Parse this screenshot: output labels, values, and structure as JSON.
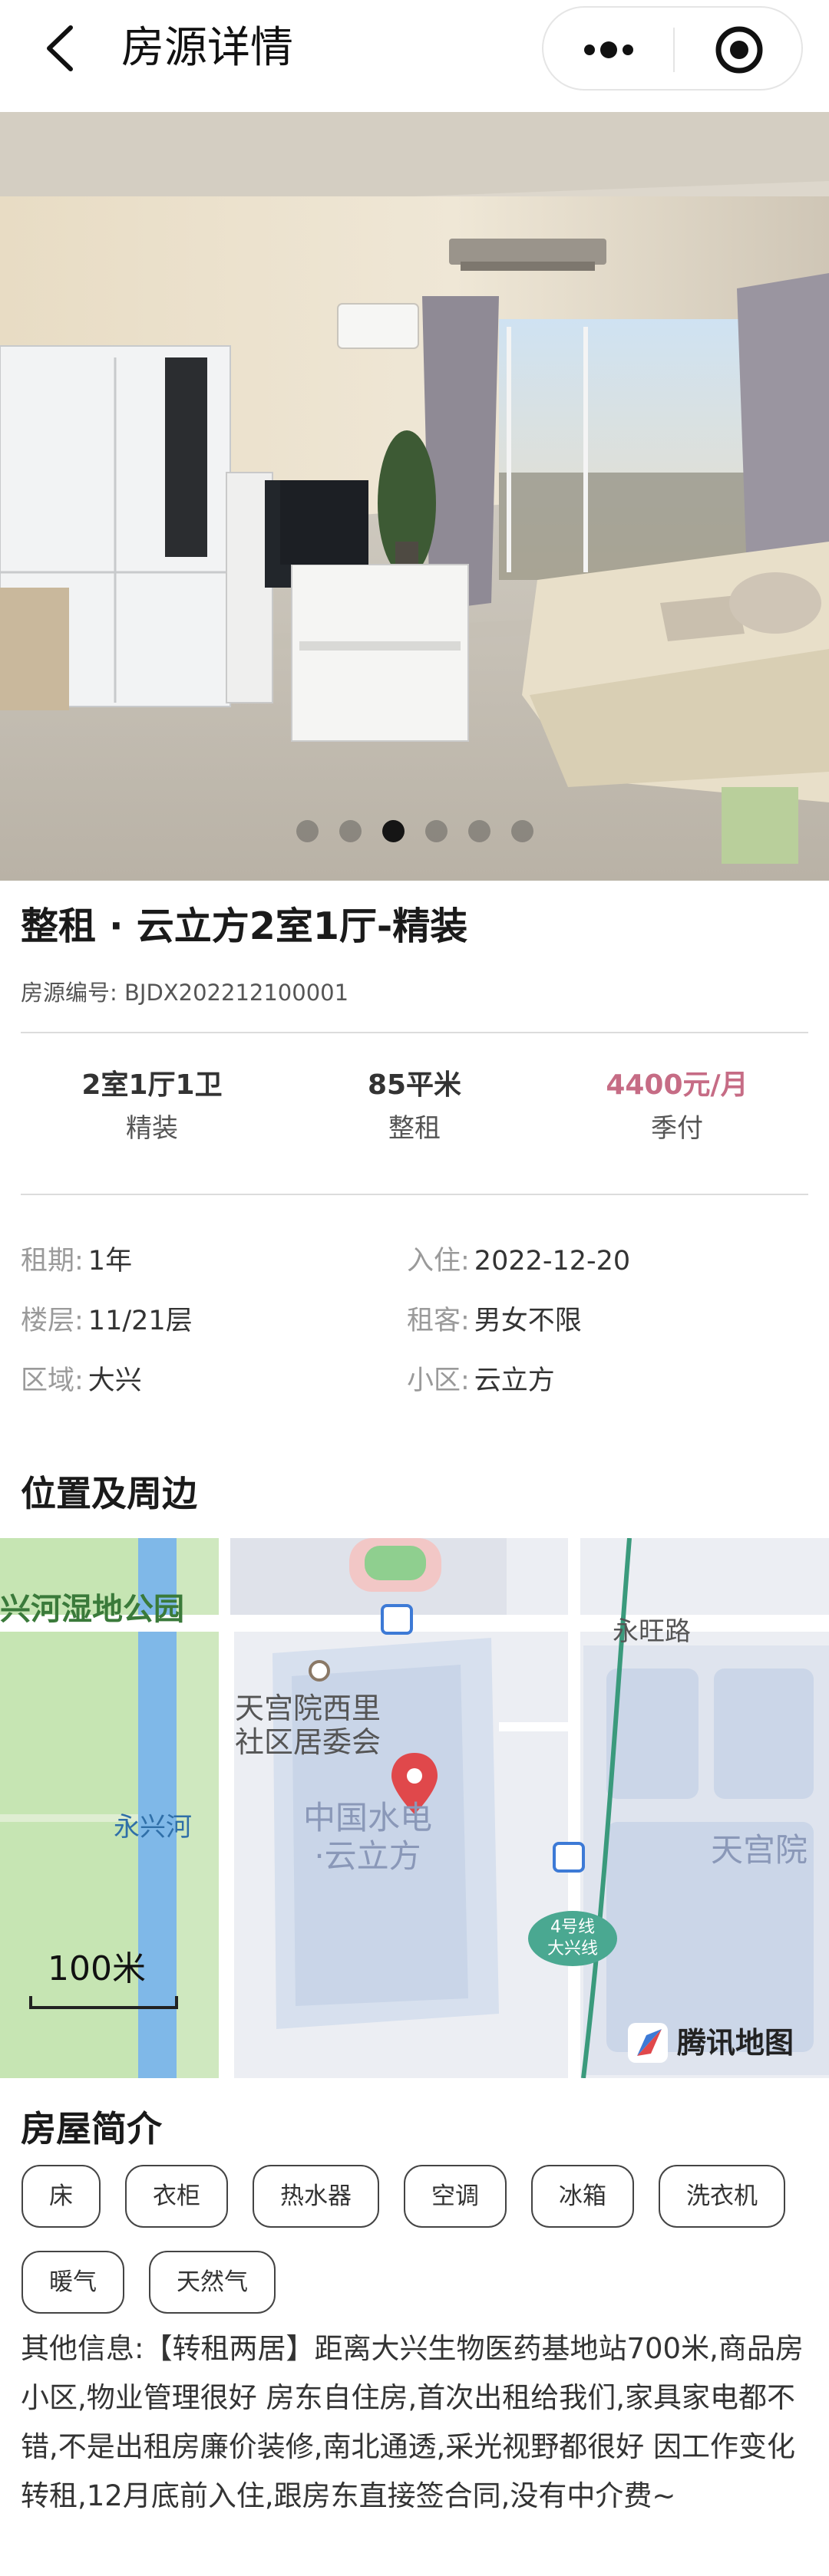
{
  "header": {
    "title": "房源详情",
    "back_icon": "chevron-left-icon",
    "more_icon": "more-dots-icon",
    "target_icon": "record-target-icon"
  },
  "gallery": {
    "photo_count": 6,
    "active_index": 2
  },
  "listing": {
    "title": "整租 · 云立方2室1厅-精装",
    "code_label": "房源编号: ",
    "code": "BJDX202212100001"
  },
  "stats": [
    {
      "main": "2室1厅1卫",
      "sub": "精装"
    },
    {
      "main": "85平米",
      "sub": "整租"
    },
    {
      "main": "4400元/月",
      "sub": "季付"
    }
  ],
  "info": [
    {
      "key": "租期:",
      "value": "1年"
    },
    {
      "key": "入住:",
      "value": "2022-12-20"
    },
    {
      "key": "楼层:",
      "value": "11/21层"
    },
    {
      "key": "租客:",
      "value": "男女不限"
    },
    {
      "key": "区域:",
      "value": "大兴"
    },
    {
      "key": "小区:",
      "value": "云立方"
    }
  ],
  "location": {
    "section_title": "位置及周边",
    "map": {
      "park_label": "兴河湿地公园",
      "river_label": "永兴河",
      "road_label": "永旺路",
      "committee_label_1": "天宫院西里",
      "committee_label_2": "社区居委会",
      "complex_label_1": "中国水电",
      "complex_label_2": "·云立方",
      "area_label": "天宫院",
      "metro_label_1": "4号线",
      "metro_label_2": "大兴线",
      "scale_label": "100米",
      "provider_label": "腾讯地图"
    }
  },
  "amenities": {
    "section_title": "房屋简介",
    "tags": [
      "床",
      "衣柜",
      "热水器",
      "空调",
      "冰箱",
      "洗衣机",
      "暖气",
      "天然气"
    ]
  },
  "other_info": "其他信息:【转租两居】距离大兴生物医药基地站700米,商品房小区,物业管理很好 房东自住房,首次出租给我们,家具家电都不错,不是出租房廉价装修,南北通透,采光视野都很好 因工作变化转租,12月底前入住,跟房东直接签合同,没有中介费~",
  "colors": {
    "price": "#c66c85",
    "metro_line": "#3a9a7c",
    "river": "#7fb8e8",
    "park": "#c6e5b3",
    "pin": "#e0484b"
  }
}
